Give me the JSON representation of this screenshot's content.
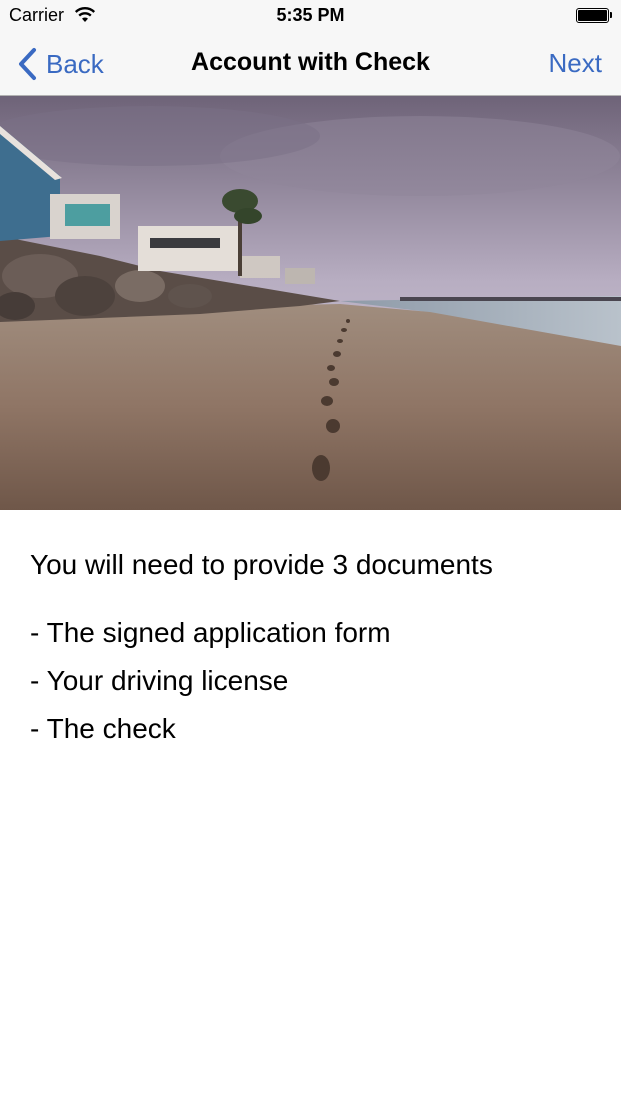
{
  "status_bar": {
    "carrier": "Carrier",
    "time": "5:35 PM"
  },
  "nav": {
    "back_label": "Back",
    "title": "Account with Check",
    "next_label": "Next"
  },
  "accent_color": "#3a6ac2",
  "hero": {
    "subject": "beach with footprints in the sand"
  },
  "content": {
    "intro": "You will need to provide 3 documents",
    "documents": [
      "- The signed application form",
      "- Your driving license",
      "- The check"
    ]
  }
}
